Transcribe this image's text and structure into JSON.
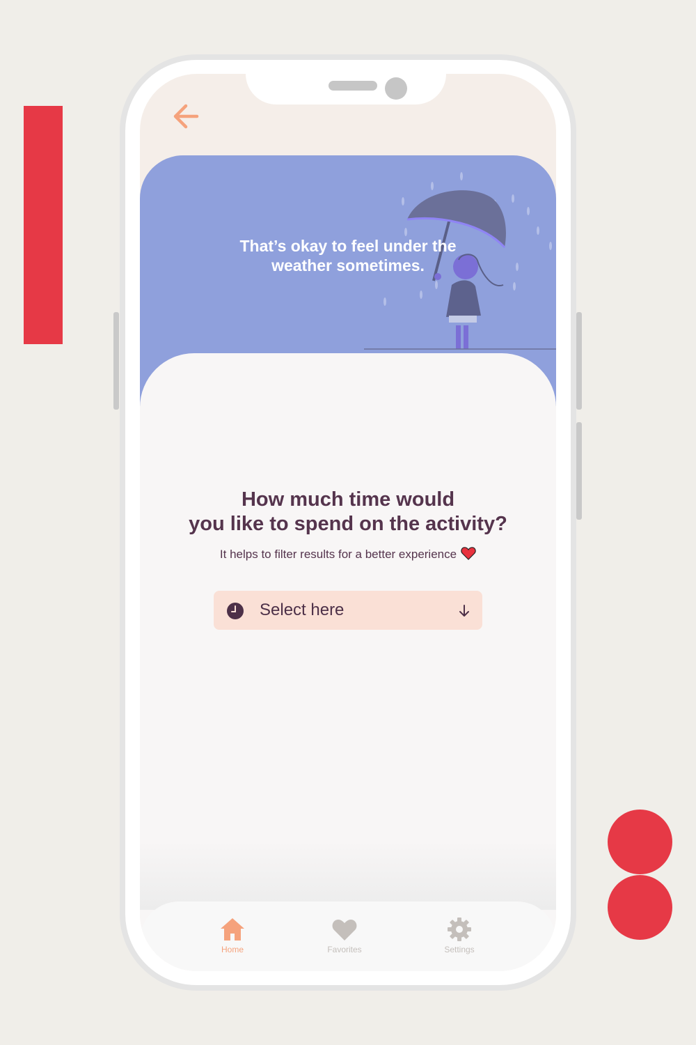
{
  "header": {
    "back_icon": "arrow-left-icon"
  },
  "hero": {
    "message": "That’s okay to feel under the\nweather sometimes.",
    "background_color": "#8fa0dc"
  },
  "question": {
    "title": "How much time would\nyou like to spend on the activity?",
    "subtitle": "It helps to filter results for a better experience"
  },
  "select": {
    "label": "Select here",
    "icon": "clock-icon",
    "dropdown_icon": "arrow-down-icon"
  },
  "tabbar": {
    "tabs": [
      {
        "label": "Home",
        "icon": "home-icon",
        "active": true
      },
      {
        "label": "Favorites",
        "icon": "heart-icon",
        "active": false
      },
      {
        "label": "Settings",
        "icon": "gear-icon",
        "active": false
      }
    ],
    "active_color": "#f5a27c",
    "inactive_color": "#c4bfbb"
  },
  "colors": {
    "accent": "#e63946",
    "text": "#55344d",
    "select_bg": "#fae0d6"
  }
}
